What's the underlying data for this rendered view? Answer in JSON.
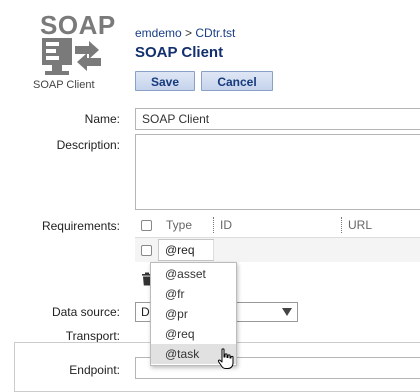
{
  "logo": {
    "title": "SOAP",
    "caption": "SOAP Client",
    "icon": "soap-client-icon"
  },
  "breadcrumb": {
    "part1": "emdemo",
    "separator": ">",
    "part2": "CDtr.tst"
  },
  "page_title": "SOAP Client",
  "toolbar": {
    "save_label": "Save",
    "cancel_label": "Cancel"
  },
  "form": {
    "name_label": "Name:",
    "name_value": "SOAP Client",
    "description_label": "Description:",
    "description_value": "",
    "requirements_label": "Requirements:",
    "data_source_label": "Data source:",
    "data_source_value": "D",
    "transport_label": "Transport:",
    "endpoint_label": "Endpoint:",
    "endpoint_value": ""
  },
  "requirements": {
    "columns": [
      "Type",
      "ID",
      "URL"
    ],
    "rows": [
      {
        "type": "@req",
        "id": "",
        "url": ""
      }
    ]
  },
  "type_dropdown": {
    "options": [
      "@asset",
      "@fr",
      "@pr",
      "@req",
      "@task"
    ],
    "highlighted": "@task"
  },
  "colors": {
    "accent": "#12306e",
    "button_bg": "#c5d3ec",
    "button_border": "#8aa0c7"
  }
}
